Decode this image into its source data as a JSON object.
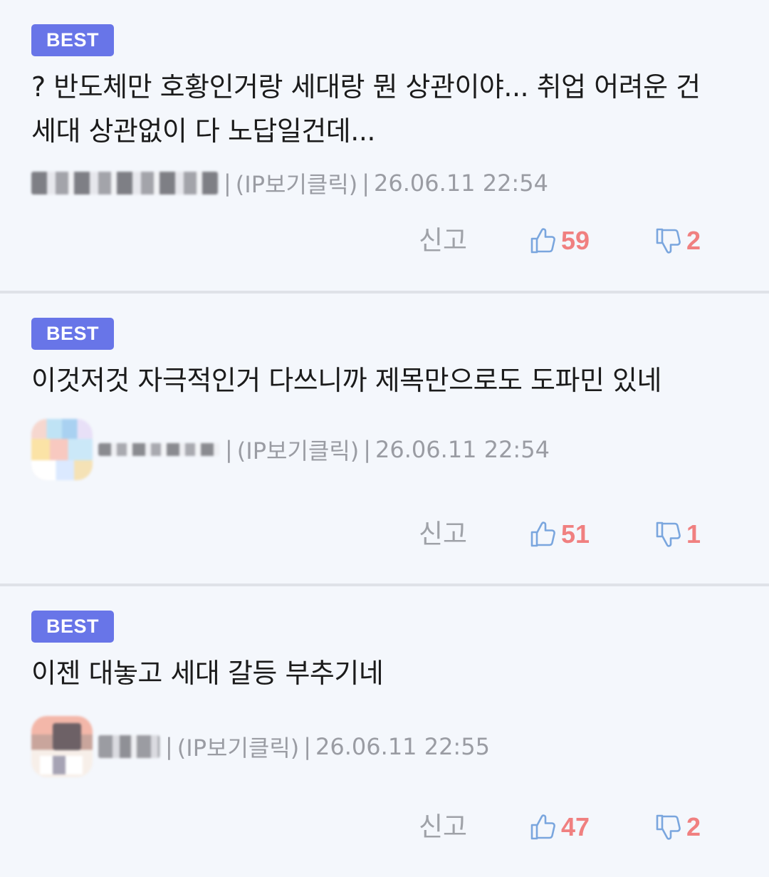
{
  "comments": [
    {
      "badge": "BEST",
      "text": "? 반도체만 호황인거랑 세대랑 뭔 상관이야... 취업 어려운 건 세대 상관없이 다 노답일건데...",
      "separator": "|",
      "ip_label": "(IP보기클릭)",
      "separator2": "|",
      "timestamp": "26.06.11 22:54",
      "report_label": "신고",
      "likes": "59",
      "dislikes": "2"
    },
    {
      "badge": "BEST",
      "text": "이것저것 자극적인거 다쓰니까 제목만으로도 도파민 있네",
      "separator": "|",
      "ip_label": "(IP보기클릭)",
      "separator2": "|",
      "timestamp": "26.06.11 22:54",
      "report_label": "신고",
      "likes": "51",
      "dislikes": "1"
    },
    {
      "badge": "BEST",
      "text": "이젠 대놓고 세대 갈등 부추기네",
      "separator": "|",
      "ip_label": "(IP보기클릭)",
      "separator2": "|",
      "timestamp": "26.06.11 22:55",
      "report_label": "신고",
      "likes": "47",
      "dislikes": "2"
    }
  ],
  "icons": {
    "like": "thumbs-up-icon",
    "dislike": "thumbs-down-icon"
  },
  "colors": {
    "badge": "#6875e8",
    "count": "#f08080",
    "icon": "#7aa6de",
    "meta": "#9a9ca3",
    "background": "#f4f7fc"
  }
}
